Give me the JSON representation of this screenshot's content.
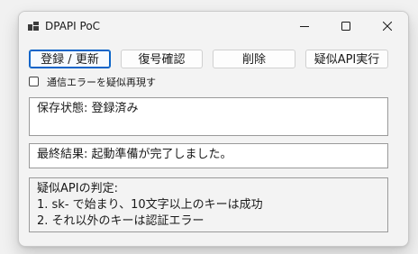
{
  "window": {
    "title": "DPAPI PoC",
    "icon": "app-window-icon",
    "controls": {
      "minimize": "minimize-icon",
      "maximize": "maximize-icon",
      "close": "close-icon"
    }
  },
  "toolbar": {
    "register_label": "登録 / 更新",
    "check_label": "復号確認",
    "delete_label": "削除",
    "execute_label": "疑似API実行"
  },
  "options": {
    "simulate_auth_error_label": "通信エラーを疑似再現す",
    "simulate_auth_error_checked": false
  },
  "status": {
    "text": "保存状態: 登録済み"
  },
  "result": {
    "text": "最終結果: 起動準備が完了しました。"
  },
  "rules": {
    "lines": [
      "疑似APIの判定:",
      "1. sk- で始まり、10文字以上のキーは成功",
      "2. それ以外のキーは認証エラー"
    ]
  },
  "colors": {
    "accent": "#0a64c8",
    "window_bg": "#f3f3f3",
    "field_bg": "#ffffff"
  }
}
